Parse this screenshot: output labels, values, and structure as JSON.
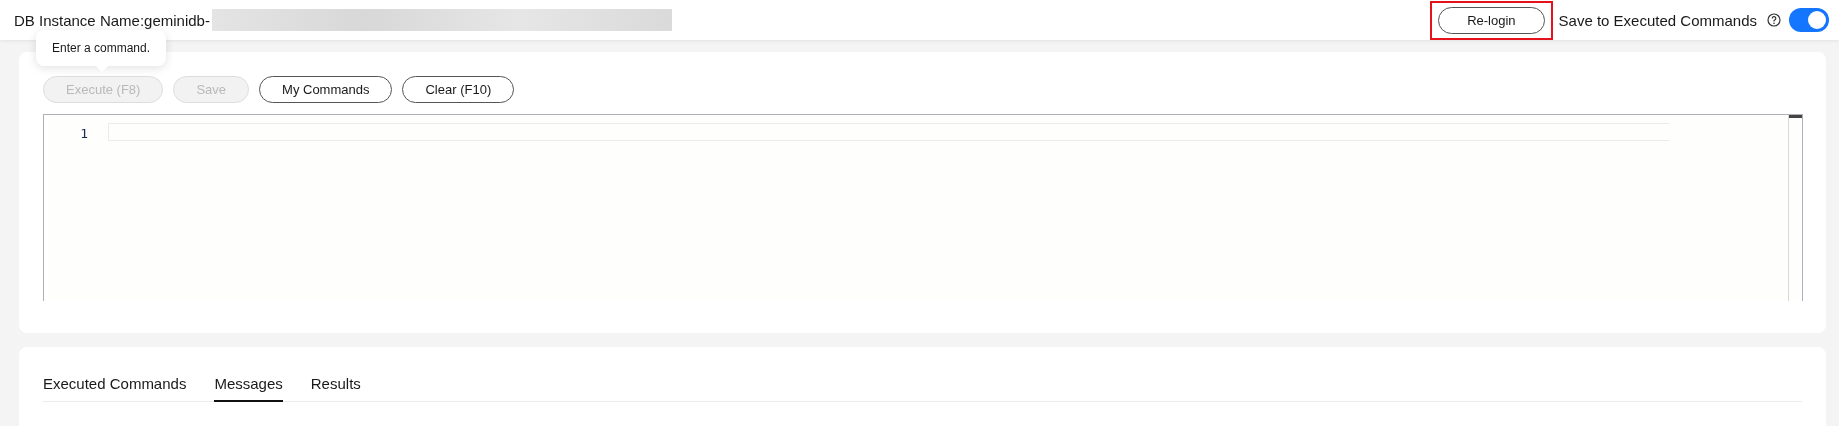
{
  "header": {
    "instance_label": "DB Instance Name:geminidb-",
    "relogin_button": "Re-login",
    "relogin_highlighted": true,
    "save_toggle": {
      "label": "Save to Executed Commands",
      "on": true
    }
  },
  "tooltip": "Enter a command.",
  "toolbar": [
    {
      "label": "Execute (F8)",
      "disabled": true
    },
    {
      "label": "Save",
      "disabled": true
    },
    {
      "label": "My Commands",
      "disabled": false
    },
    {
      "label": "Clear (F10)",
      "disabled": false
    }
  ],
  "editor": {
    "line_numbers": [
      "1"
    ]
  },
  "tabs": [
    {
      "label": "Executed Commands",
      "selected": false
    },
    {
      "label": "Messages",
      "selected": true
    },
    {
      "label": "Results",
      "selected": false
    }
  ]
}
